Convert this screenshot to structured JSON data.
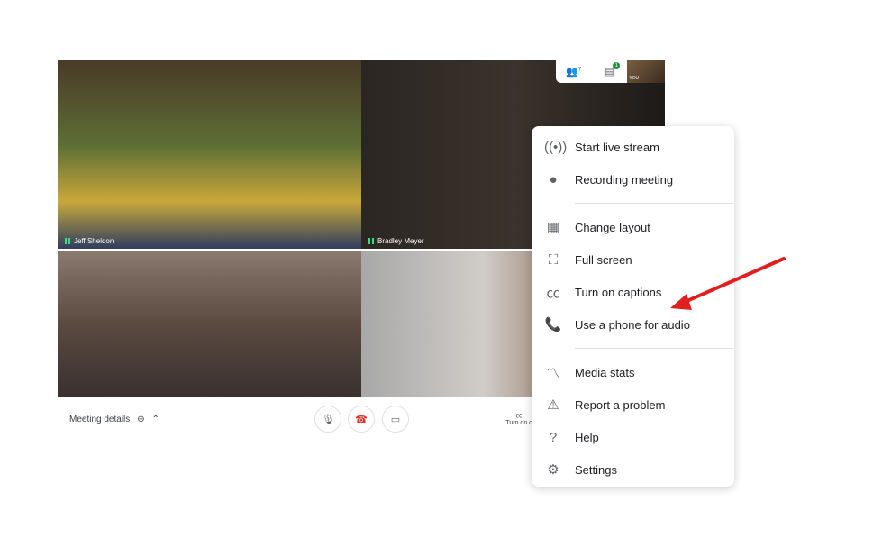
{
  "participants": [
    {
      "name": "Jeff Sheldon"
    },
    {
      "name": "Bradley Meyer"
    },
    {
      "name": ""
    },
    {
      "name": ""
    }
  ],
  "topbar": {
    "people_count": "7",
    "chat_badge": "1",
    "self_label": "YOU"
  },
  "menu": {
    "items": [
      {
        "icon": "live-stream-icon",
        "glyph": "((•))",
        "label": "Start live stream"
      },
      {
        "icon": "record-icon",
        "glyph": "●",
        "label": "Recording meeting"
      },
      {
        "sep": true
      },
      {
        "icon": "grid-layout-icon",
        "glyph": "▦",
        "label": "Change layout"
      },
      {
        "icon": "fullscreen-icon",
        "glyph": "⛶",
        "label": "Full screen"
      },
      {
        "icon": "captions-icon",
        "glyph": "㏄",
        "label": "Turn on captions"
      },
      {
        "icon": "phone-audio-icon",
        "glyph": "📞",
        "label": "Use a phone for audio"
      },
      {
        "sep": true
      },
      {
        "icon": "media-stats-icon",
        "glyph": "〽",
        "label": "Media stats"
      },
      {
        "icon": "report-problem-icon",
        "glyph": "⚠",
        "label": "Report a problem"
      },
      {
        "icon": "help-icon",
        "glyph": "?",
        "label": "Help"
      },
      {
        "icon": "settings-icon",
        "glyph": "⚙",
        "label": "Settings"
      }
    ]
  },
  "bottom": {
    "meeting_details": "Meeting details",
    "captions": "Turn on c"
  },
  "colors": {
    "accent": "#1e8e3e",
    "hangup": "#d93025",
    "arrow": "#e02020"
  }
}
